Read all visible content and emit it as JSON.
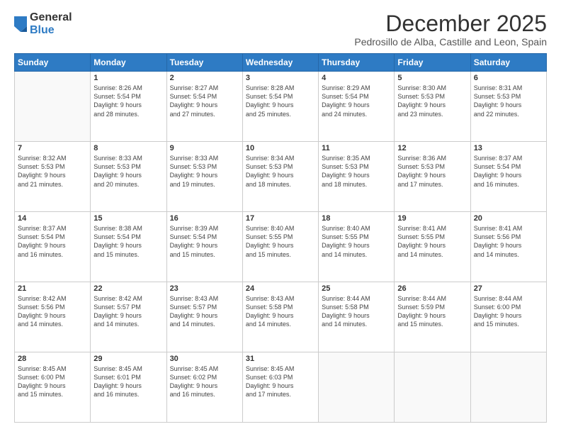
{
  "logo": {
    "general": "General",
    "blue": "Blue"
  },
  "header": {
    "month": "December 2025",
    "location": "Pedrosillo de Alba, Castille and Leon, Spain"
  },
  "weekdays": [
    "Sunday",
    "Monday",
    "Tuesday",
    "Wednesday",
    "Thursday",
    "Friday",
    "Saturday"
  ],
  "weeks": [
    [
      {
        "day": "",
        "info": ""
      },
      {
        "day": "1",
        "info": "Sunrise: 8:26 AM\nSunset: 5:54 PM\nDaylight: 9 hours\nand 28 minutes."
      },
      {
        "day": "2",
        "info": "Sunrise: 8:27 AM\nSunset: 5:54 PM\nDaylight: 9 hours\nand 27 minutes."
      },
      {
        "day": "3",
        "info": "Sunrise: 8:28 AM\nSunset: 5:54 PM\nDaylight: 9 hours\nand 25 minutes."
      },
      {
        "day": "4",
        "info": "Sunrise: 8:29 AM\nSunset: 5:54 PM\nDaylight: 9 hours\nand 24 minutes."
      },
      {
        "day": "5",
        "info": "Sunrise: 8:30 AM\nSunset: 5:53 PM\nDaylight: 9 hours\nand 23 minutes."
      },
      {
        "day": "6",
        "info": "Sunrise: 8:31 AM\nSunset: 5:53 PM\nDaylight: 9 hours\nand 22 minutes."
      }
    ],
    [
      {
        "day": "7",
        "info": "Sunrise: 8:32 AM\nSunset: 5:53 PM\nDaylight: 9 hours\nand 21 minutes."
      },
      {
        "day": "8",
        "info": "Sunrise: 8:33 AM\nSunset: 5:53 PM\nDaylight: 9 hours\nand 20 minutes."
      },
      {
        "day": "9",
        "info": "Sunrise: 8:33 AM\nSunset: 5:53 PM\nDaylight: 9 hours\nand 19 minutes."
      },
      {
        "day": "10",
        "info": "Sunrise: 8:34 AM\nSunset: 5:53 PM\nDaylight: 9 hours\nand 18 minutes."
      },
      {
        "day": "11",
        "info": "Sunrise: 8:35 AM\nSunset: 5:53 PM\nDaylight: 9 hours\nand 18 minutes."
      },
      {
        "day": "12",
        "info": "Sunrise: 8:36 AM\nSunset: 5:53 PM\nDaylight: 9 hours\nand 17 minutes."
      },
      {
        "day": "13",
        "info": "Sunrise: 8:37 AM\nSunset: 5:54 PM\nDaylight: 9 hours\nand 16 minutes."
      }
    ],
    [
      {
        "day": "14",
        "info": "Sunrise: 8:37 AM\nSunset: 5:54 PM\nDaylight: 9 hours\nand 16 minutes."
      },
      {
        "day": "15",
        "info": "Sunrise: 8:38 AM\nSunset: 5:54 PM\nDaylight: 9 hours\nand 15 minutes."
      },
      {
        "day": "16",
        "info": "Sunrise: 8:39 AM\nSunset: 5:54 PM\nDaylight: 9 hours\nand 15 minutes."
      },
      {
        "day": "17",
        "info": "Sunrise: 8:40 AM\nSunset: 5:55 PM\nDaylight: 9 hours\nand 15 minutes."
      },
      {
        "day": "18",
        "info": "Sunrise: 8:40 AM\nSunset: 5:55 PM\nDaylight: 9 hours\nand 14 minutes."
      },
      {
        "day": "19",
        "info": "Sunrise: 8:41 AM\nSunset: 5:55 PM\nDaylight: 9 hours\nand 14 minutes."
      },
      {
        "day": "20",
        "info": "Sunrise: 8:41 AM\nSunset: 5:56 PM\nDaylight: 9 hours\nand 14 minutes."
      }
    ],
    [
      {
        "day": "21",
        "info": "Sunrise: 8:42 AM\nSunset: 5:56 PM\nDaylight: 9 hours\nand 14 minutes."
      },
      {
        "day": "22",
        "info": "Sunrise: 8:42 AM\nSunset: 5:57 PM\nDaylight: 9 hours\nand 14 minutes."
      },
      {
        "day": "23",
        "info": "Sunrise: 8:43 AM\nSunset: 5:57 PM\nDaylight: 9 hours\nand 14 minutes."
      },
      {
        "day": "24",
        "info": "Sunrise: 8:43 AM\nSunset: 5:58 PM\nDaylight: 9 hours\nand 14 minutes."
      },
      {
        "day": "25",
        "info": "Sunrise: 8:44 AM\nSunset: 5:58 PM\nDaylight: 9 hours\nand 14 minutes."
      },
      {
        "day": "26",
        "info": "Sunrise: 8:44 AM\nSunset: 5:59 PM\nDaylight: 9 hours\nand 15 minutes."
      },
      {
        "day": "27",
        "info": "Sunrise: 8:44 AM\nSunset: 6:00 PM\nDaylight: 9 hours\nand 15 minutes."
      }
    ],
    [
      {
        "day": "28",
        "info": "Sunrise: 8:45 AM\nSunset: 6:00 PM\nDaylight: 9 hours\nand 15 minutes."
      },
      {
        "day": "29",
        "info": "Sunrise: 8:45 AM\nSunset: 6:01 PM\nDaylight: 9 hours\nand 16 minutes."
      },
      {
        "day": "30",
        "info": "Sunrise: 8:45 AM\nSunset: 6:02 PM\nDaylight: 9 hours\nand 16 minutes."
      },
      {
        "day": "31",
        "info": "Sunrise: 8:45 AM\nSunset: 6:03 PM\nDaylight: 9 hours\nand 17 minutes."
      },
      {
        "day": "",
        "info": ""
      },
      {
        "day": "",
        "info": ""
      },
      {
        "day": "",
        "info": ""
      }
    ]
  ]
}
